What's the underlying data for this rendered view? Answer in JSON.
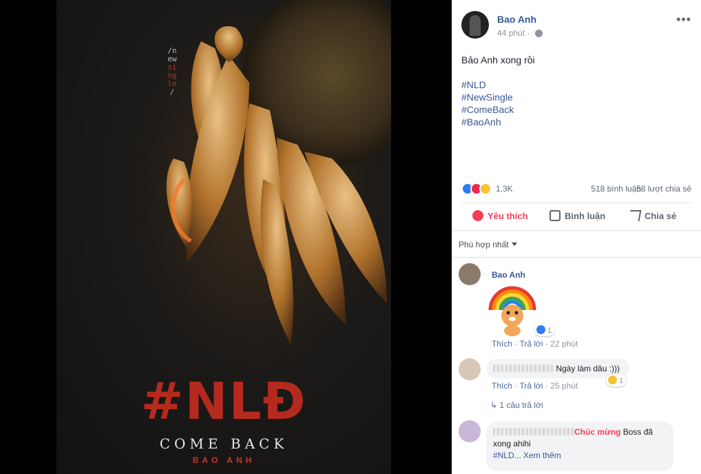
{
  "photo": {
    "vertical_text_top": "/new",
    "vertical_text_red": "single",
    "vertical_text_bottom": "/",
    "title": "#NLĐ",
    "subtitle": "COME BACK",
    "artist": "BAO ANH"
  },
  "post": {
    "author": "Bao Anh",
    "time": "44 phút",
    "more": "•••",
    "text": "Bảo Anh xong rồi",
    "hashtags": [
      "#NLD",
      "#NewSingle",
      "#ComeBack",
      "#BaoAnh"
    ],
    "reaction_count": "1,3K",
    "comments_count": "518 bình luận",
    "shares_count": "58 lượt chia sẻ"
  },
  "actions": {
    "like": "Yêu thích",
    "comment": "Bình luận",
    "share": "Chia sẻ"
  },
  "sort": {
    "label": "Phù hợp nhất"
  },
  "comments": [
    {
      "name": "Bao Anh",
      "reaction_count": "1",
      "like": "Thích",
      "reply": "Trả lời",
      "time": "22 phút"
    },
    {
      "text": "Ngày làm dâu :)))",
      "reaction_count": "1",
      "like": "Thích",
      "reply": "Trả lời",
      "time": "25 phút",
      "replies": "1 câu trả lời"
    },
    {
      "mention": "Chúc mừng",
      "text_1": "Boss đã",
      "text_2": "xong ahihi",
      "tag": "#NLD...",
      "see_more": "Xem thêm"
    }
  ],
  "colors": {
    "link": "#365899",
    "like_red": "#f33e58",
    "poster_red": "#b52a1e"
  }
}
